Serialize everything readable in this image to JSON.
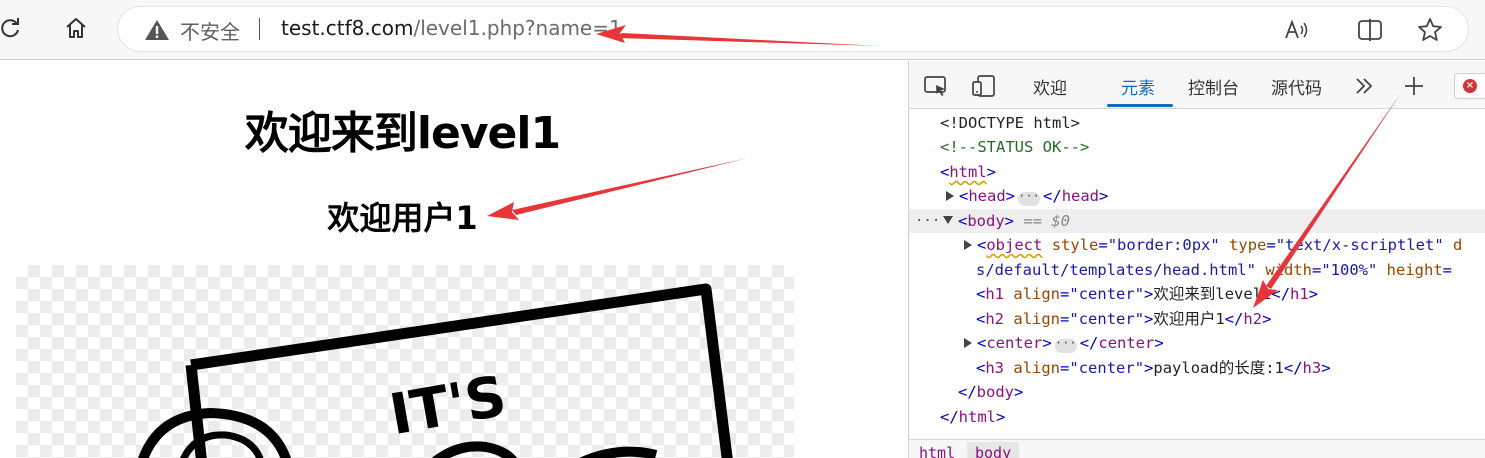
{
  "toolbar": {
    "insecure_label": "不安全",
    "url_host": "test.ctf8.com",
    "url_path": "/level1.php?name=1"
  },
  "page": {
    "heading": "欢迎来到level1",
    "subheading": "欢迎用户1",
    "comic_text": "IT'S"
  },
  "devtools": {
    "tabs": [
      "欢迎",
      "元素",
      "控制台",
      "源代码"
    ],
    "active_tab": "元素",
    "selected_var": "== $0",
    "lines": {
      "doctype": "<!DOCTYPE html>",
      "comment": "<!--STATUS OK-->",
      "html_open": "html",
      "head": "head",
      "body_open": "body",
      "object_tag": "object",
      "object_style_attr": "style",
      "object_style_val": "\"border:0px\"",
      "object_type_attr": "type",
      "object_type_val": "\"text/x-scriptlet\"",
      "object_cont_val": "s/default/templates/head.html\"",
      "object_width_attr": "width",
      "object_width_val": "\"100%\"",
      "object_height_attr": "height",
      "h1_tag": "h1",
      "h1_align_attr": "align",
      "h1_align_val": "\"center\"",
      "h1_text": "欢迎来到level1",
      "h2_tag": "h2",
      "h2_align_attr": "align",
      "h2_align_val": "\"center\"",
      "h2_text": "欢迎用户1",
      "center_tag": "center",
      "h3_tag": "h3",
      "h3_align_attr": "align",
      "h3_align_val": "\"center\"",
      "h3_text": "payload的长度:1",
      "body_close": "body",
      "html_close": "html"
    },
    "breadcrumb": [
      "html",
      "body"
    ]
  },
  "colors": {
    "tab_accent": "#0f6cbd",
    "annotation_arrow": "#e8353a",
    "error_badge": "#d13438"
  }
}
